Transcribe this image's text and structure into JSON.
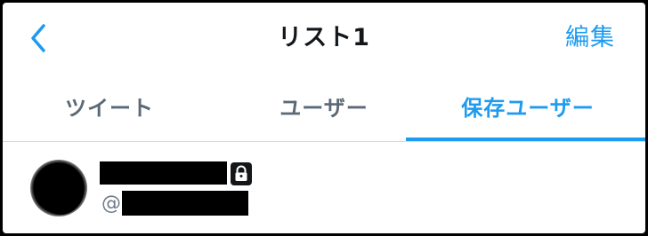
{
  "nav": {
    "back_icon": "chevron-left-icon",
    "title": "リスト1",
    "edit_label": "編集"
  },
  "tabs": [
    {
      "label": "ツイート",
      "active": false
    },
    {
      "label": "ユーザー",
      "active": false
    },
    {
      "label": "保存ユーザー",
      "active": true
    }
  ],
  "saved_users": [
    {
      "avatar": "avatar-image",
      "name": "",
      "protected": true,
      "protected_icon": "lock-icon",
      "handle_prefix": "@",
      "handle": ""
    }
  ],
  "colors": {
    "accent": "#1d9bf0",
    "text_primary": "#14171a",
    "text_secondary": "#5b6875",
    "divider": "#d6dbe0"
  }
}
